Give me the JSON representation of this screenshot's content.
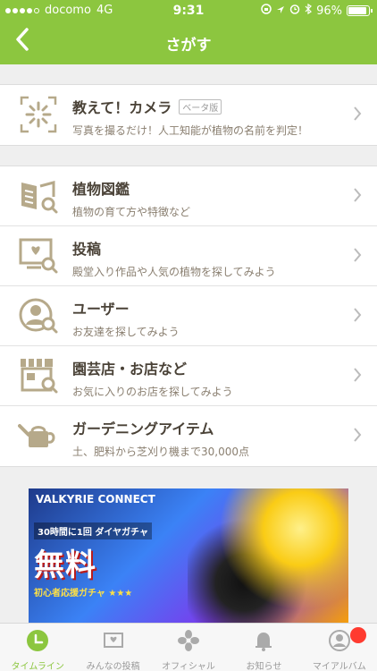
{
  "status_bar": {
    "carrier": "docomo",
    "network": "4G",
    "time": "9:31",
    "battery_text": "96%"
  },
  "nav": {
    "title": "さがす",
    "back_icon": "chevron-left-icon"
  },
  "sections": [
    {
      "items": [
        {
          "title": "教えて！カメラ",
          "badge": "ベータ版",
          "subtitle": "写真を撮るだけ！人工知能が植物の名前を判定！",
          "icon": "camera-ai-icon"
        }
      ]
    },
    {
      "items": [
        {
          "title": "植物図鑑",
          "subtitle": "植物の育て方や特徴など",
          "icon": "encyclopedia-icon"
        },
        {
          "title": "投稿",
          "subtitle": "殿堂入り作品や人気の植物を探してみよう",
          "icon": "post-search-icon"
        },
        {
          "title": "ユーザー",
          "subtitle": "お友達を探してみよう",
          "icon": "user-search-icon"
        },
        {
          "title": "園芸店・お店など",
          "subtitle": "お気に入りのお店を探してみよう",
          "icon": "store-search-icon"
        },
        {
          "title": "ガーデニングアイテム",
          "subtitle": "土、肥料から芝刈り機まで30,000点",
          "icon": "watering-can-icon"
        }
      ]
    }
  ],
  "banner": {
    "logo": "VALKYRIE CONNECT",
    "promo_line1": "30時間に1回 ダイヤガチャ",
    "promo_line2": "無料",
    "promo_line3": "初心者応援ガチャ ★★★"
  },
  "tabbar": [
    {
      "label": "タイムライン",
      "icon": "timeline-icon",
      "active": true
    },
    {
      "label": "みんなの投稿",
      "icon": "posts-icon",
      "active": false
    },
    {
      "label": "オフィシャル",
      "icon": "official-flower-icon",
      "active": false
    },
    {
      "label": "お知らせ",
      "icon": "bell-icon",
      "active": false
    },
    {
      "label": "マイアルバム",
      "icon": "profile-icon",
      "active": false
    }
  ],
  "colors": {
    "brand_green": "#8cc63f",
    "icon_khaki": "#b6a98a",
    "notification_red": "#ff3b30"
  }
}
